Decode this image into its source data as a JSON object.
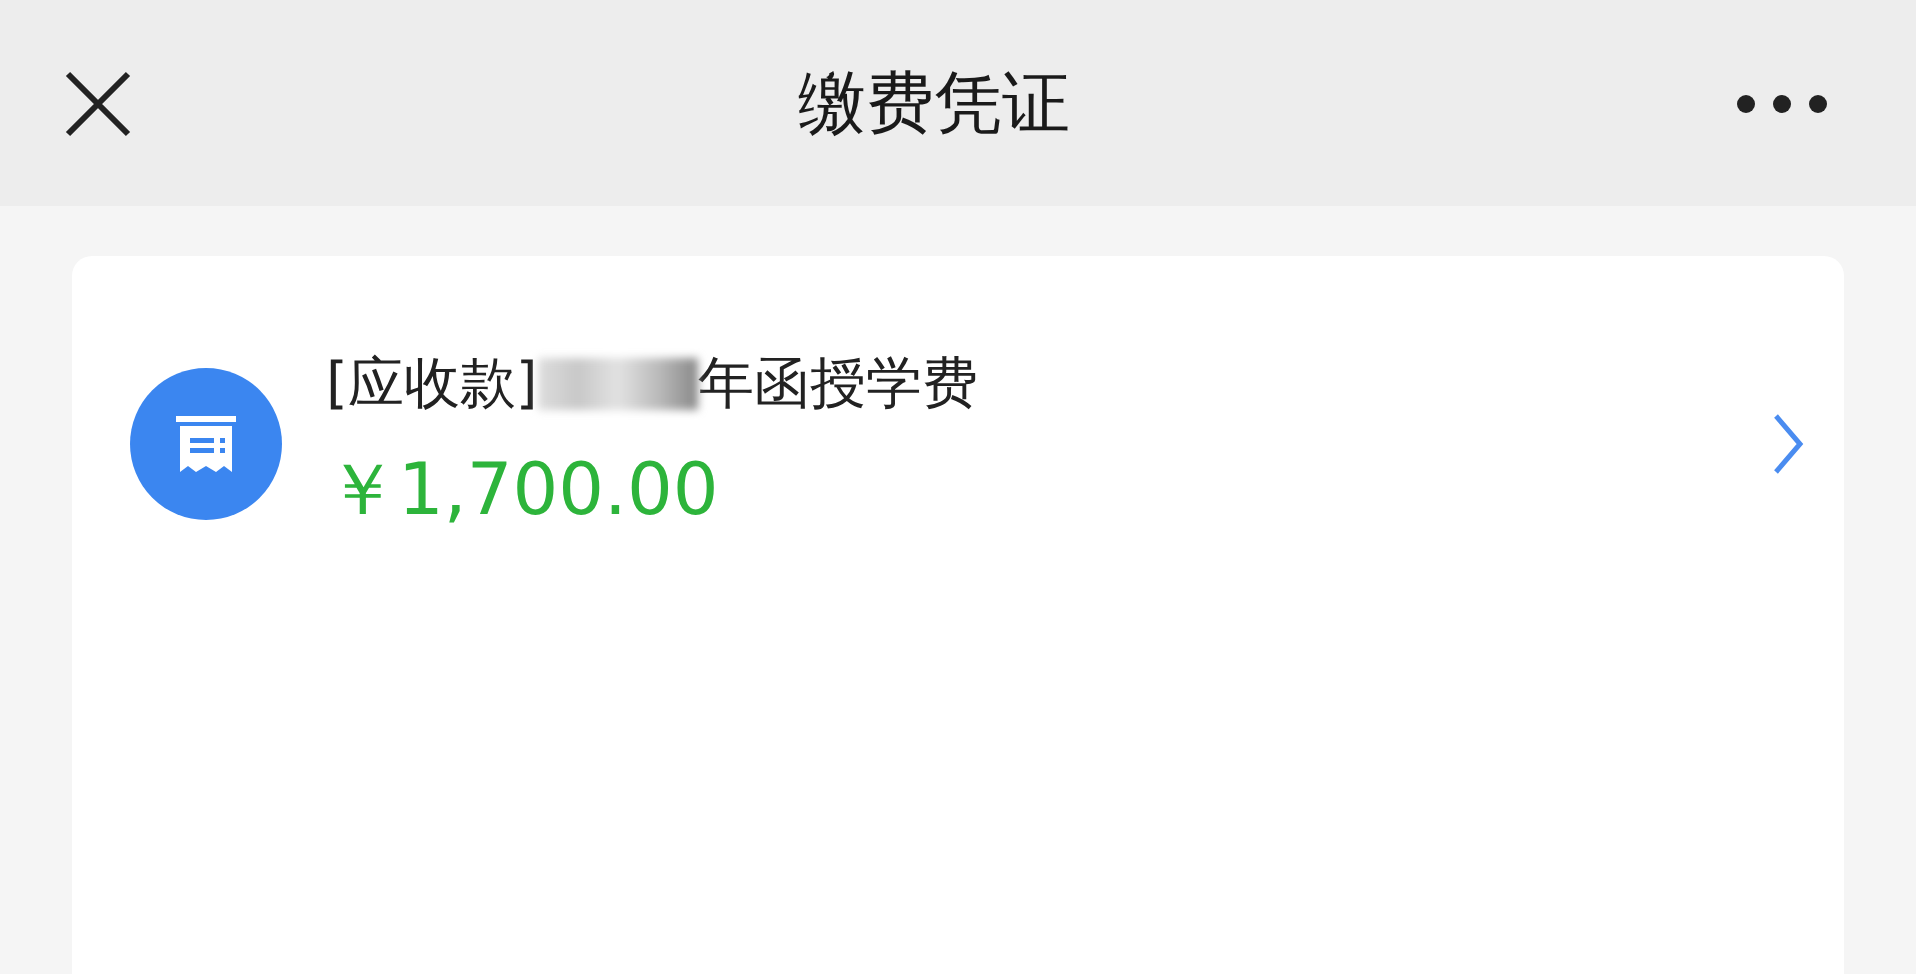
{
  "header": {
    "title": "缴费凭证"
  },
  "items": [
    {
      "label_prefix": "[应收款]",
      "redacted": true,
      "label_suffix": "年函授学费",
      "amount": "￥1,700.00"
    }
  ]
}
